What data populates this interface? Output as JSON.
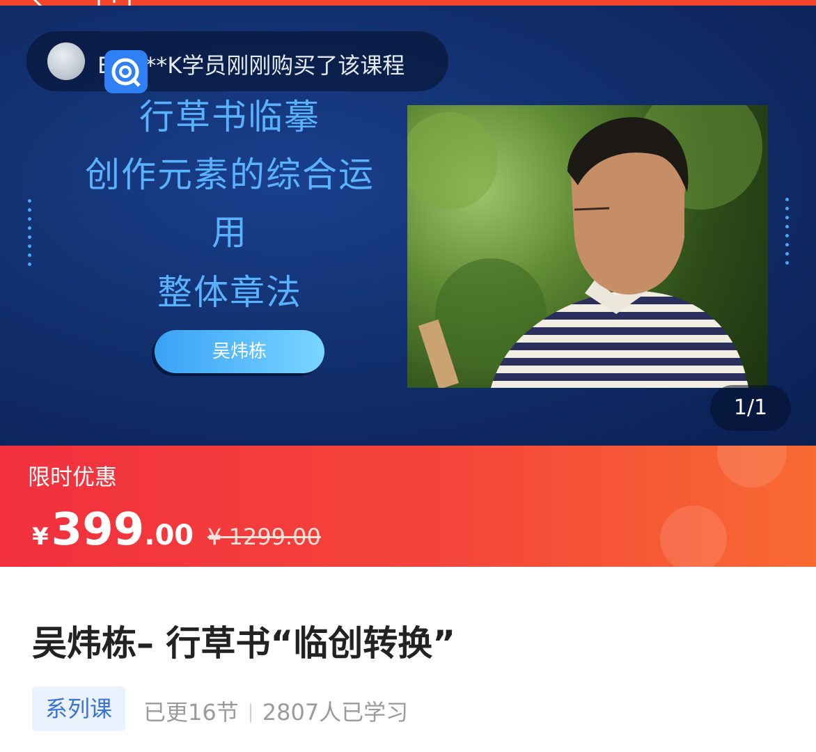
{
  "banner": {
    "notice": "E*****K学员刚刚购买了该课程",
    "title_lines": [
      "行草书临摹",
      "创作元素的综合运",
      "用",
      "整体章法"
    ],
    "author_button": "吴炜栋",
    "page_indicator": "1/1"
  },
  "price": {
    "promo_label": "限时优惠",
    "currency": "¥",
    "price_integer": "399",
    "price_decimal": ".00",
    "original_price": "¥ 1299.00"
  },
  "course": {
    "title": "吴炜栋– 行草书“临创转换”",
    "series_tag": "系列课",
    "updated": "已更16节",
    "learners": "2807人已学习"
  },
  "colors": {
    "accent_red": "#f2452b",
    "banner_blue": "#12306f",
    "title_blue": "#5ab2ff",
    "tag_blue": "#3a73d6"
  },
  "icons": [
    "back-arrow-icon",
    "share-icon",
    "avatar",
    "watermark-logo-icon"
  ]
}
